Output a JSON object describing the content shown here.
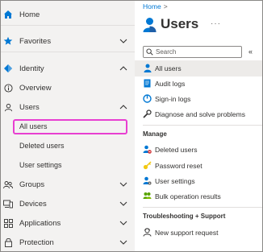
{
  "left_nav": {
    "items": [
      {
        "key": "home",
        "label": "Home",
        "icon": "home-icon",
        "chevron": "none"
      },
      {
        "key": "favorites",
        "label": "Favorites",
        "icon": "star-icon",
        "chevron": "down"
      },
      {
        "key": "identity",
        "label": "Identity",
        "icon": "identity-diamond-icon",
        "chevron": "up"
      },
      {
        "key": "overview",
        "label": "Overview",
        "icon": "info-icon",
        "chevron": "none"
      },
      {
        "key": "users",
        "label": "Users",
        "icon": "user-outline-icon",
        "chevron": "up"
      },
      {
        "key": "all_users",
        "label": "All users",
        "icon": "",
        "chevron": "none"
      },
      {
        "key": "deleted_users",
        "label": "Deleted users",
        "icon": "",
        "chevron": "none"
      },
      {
        "key": "user_settings",
        "label": "User settings",
        "icon": "",
        "chevron": "none"
      },
      {
        "key": "groups",
        "label": "Groups",
        "icon": "groups-icon",
        "chevron": "down"
      },
      {
        "key": "devices",
        "label": "Devices",
        "icon": "devices-icon",
        "chevron": "down"
      },
      {
        "key": "applications",
        "label": "Applications",
        "icon": "applications-grid-icon",
        "chevron": "down"
      },
      {
        "key": "protection",
        "label": "Protection",
        "icon": "lock-icon",
        "chevron": "down"
      }
    ],
    "selected": "All users",
    "highlight_color": "#e83fd1"
  },
  "breadcrumb": {
    "home": "Home",
    "separator": ">"
  },
  "page": {
    "title": "Users",
    "more": "···",
    "icon": "users-person-icon"
  },
  "search": {
    "placeholder": "Search",
    "collapse": "«"
  },
  "menu": {
    "top": [
      {
        "label": "All users",
        "icon": "person-blue-icon",
        "active": true
      },
      {
        "label": "Audit logs",
        "icon": "audit-log-icon"
      },
      {
        "label": "Sign-in logs",
        "icon": "sign-in-icon"
      },
      {
        "label": "Diagnose and solve problems",
        "icon": "wrench-icon"
      }
    ],
    "manage_heading": "Manage",
    "manage": [
      {
        "label": "Deleted users",
        "icon": "deleted-users-icon"
      },
      {
        "label": "Password reset",
        "icon": "key-icon"
      },
      {
        "label": "User settings",
        "icon": "user-settings-icon"
      },
      {
        "label": "Bulk operation results",
        "icon": "bulk-operation-icon"
      }
    ],
    "troubleshoot_heading": "Troubleshooting + Support",
    "troubleshoot": [
      {
        "label": "New support request",
        "icon": "support-person-icon"
      }
    ]
  },
  "colors": {
    "accent": "#0078d4",
    "nav_bg": "#f3f2f1",
    "active_bg": "#edebe9",
    "highlight": "#e83fd1"
  }
}
